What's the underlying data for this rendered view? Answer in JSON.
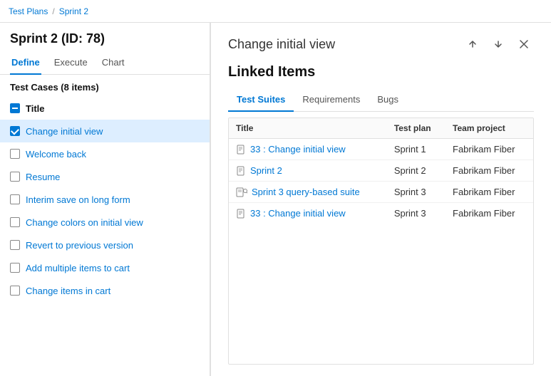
{
  "breadcrumb": {
    "part1": "Test Plans",
    "separator": "/",
    "part2": "Sprint 2"
  },
  "sprint": {
    "title": "Sprint 2 (ID: 78)"
  },
  "tabs": [
    {
      "label": "Define",
      "active": true
    },
    {
      "label": "Execute",
      "active": false
    },
    {
      "label": "Chart",
      "active": false
    }
  ],
  "testCasesHeader": "Test Cases (8 items)",
  "testItems": [
    {
      "id": 1,
      "label": "Title",
      "type": "header",
      "checked": "minus",
      "selected": false
    },
    {
      "id": 2,
      "label": "Change initial view",
      "type": "item",
      "checked": "checked",
      "selected": true
    },
    {
      "id": 3,
      "label": "Welcome back",
      "type": "item",
      "checked": "unchecked",
      "selected": false
    },
    {
      "id": 4,
      "label": "Resume",
      "type": "item",
      "checked": "unchecked",
      "selected": false
    },
    {
      "id": 5,
      "label": "Interim save on long form",
      "type": "item",
      "checked": "unchecked",
      "selected": false
    },
    {
      "id": 6,
      "label": "Change colors on initial view",
      "type": "item",
      "checked": "unchecked",
      "selected": false
    },
    {
      "id": 7,
      "label": "Revert to previous version",
      "type": "item",
      "checked": "unchecked",
      "selected": false
    },
    {
      "id": 8,
      "label": "Add multiple items to cart",
      "type": "item",
      "checked": "unchecked",
      "selected": false
    },
    {
      "id": 9,
      "label": "Change items in cart",
      "type": "item",
      "checked": "unchecked",
      "selected": false
    }
  ],
  "panel": {
    "title": "Change initial view",
    "upIcon": "↑",
    "downIcon": "↓",
    "closeIcon": "✕"
  },
  "linkedItems": {
    "title": "Linked Items",
    "tabs": [
      {
        "label": "Test Suites",
        "active": true
      },
      {
        "label": "Requirements",
        "active": false
      },
      {
        "label": "Bugs",
        "active": false
      }
    ],
    "columns": [
      "Title",
      "Test plan",
      "Team project"
    ],
    "rows": [
      {
        "icon": "doc",
        "title": "33 : Change initial view",
        "testPlan": "Sprint 1",
        "teamProject": "Fabrikam Fiber"
      },
      {
        "icon": "doc",
        "title": "Sprint 2",
        "testPlan": "Sprint 2",
        "teamProject": "Fabrikam Fiber"
      },
      {
        "icon": "doc-query",
        "title": "Sprint 3 query-based suite",
        "testPlan": "Sprint 3",
        "teamProject": "Fabrikam Fiber"
      },
      {
        "icon": "doc",
        "title": "33 : Change initial view",
        "testPlan": "Sprint 3",
        "teamProject": "Fabrikam Fiber"
      }
    ]
  }
}
